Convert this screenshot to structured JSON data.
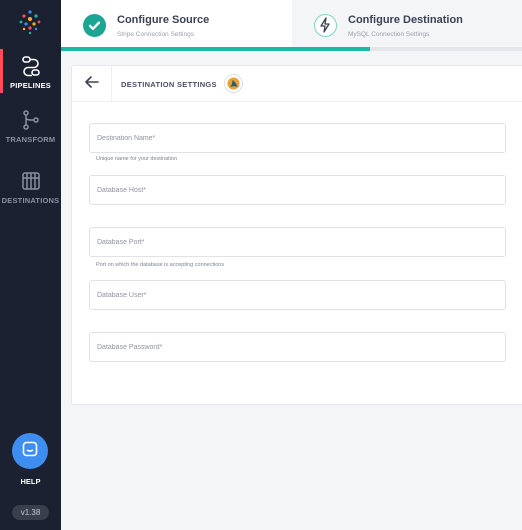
{
  "sidebar": {
    "items": [
      {
        "label": "PIPELINES",
        "icon": "pipelines-icon",
        "active": true
      },
      {
        "label": "TRANSFORM",
        "icon": "transform-icon",
        "active": false
      },
      {
        "label": "DESTINATIONS",
        "icon": "destinations-icon",
        "active": false
      }
    ],
    "help_label": "HELP",
    "version": "v1.38"
  },
  "stepper": {
    "steps": [
      {
        "title": "Configure Source",
        "subtitle": "Stripe Connection Settings",
        "state": "complete"
      },
      {
        "title": "Configure Destination",
        "subtitle": "MySQL Connection Settings",
        "state": "current"
      }
    ],
    "progress": 0.67
  },
  "card": {
    "title": "DESTINATION SETTINGS",
    "fields": [
      {
        "placeholder": "Destination Name*",
        "value": "",
        "hint": "Unique name for your destination"
      },
      {
        "placeholder": "Database Host*",
        "value": "",
        "hint": ""
      },
      {
        "placeholder": "Database Port*",
        "value": "",
        "hint": "Port on which the database is accepting connections"
      },
      {
        "placeholder": "Database User*",
        "value": "",
        "hint": ""
      },
      {
        "placeholder": "Database Password*",
        "value": "",
        "hint": ""
      }
    ]
  },
  "colors": {
    "sidebar_bg": "#1c2131",
    "accent_teal": "#1aa692",
    "active_marker": "#ff4b5c",
    "help_blue": "#3d8ef0"
  }
}
